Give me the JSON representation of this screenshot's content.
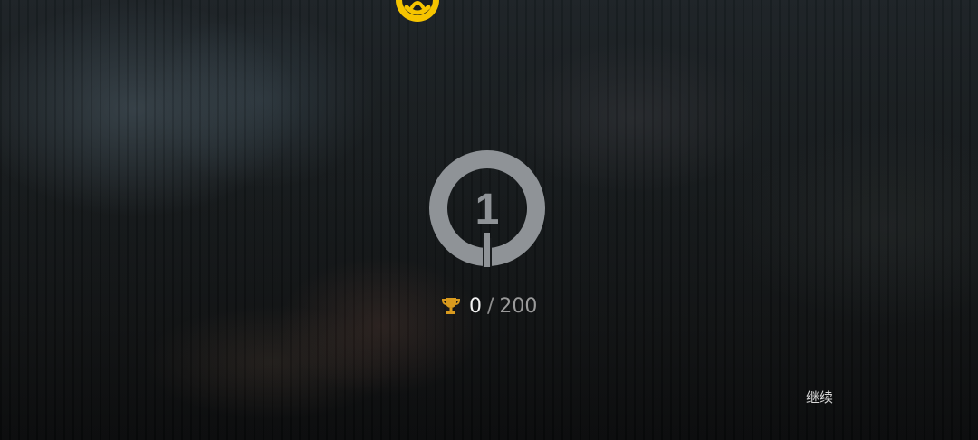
{
  "header": {
    "emblem_icon": "yellow-crest-icon",
    "emblem_color": "#f6c400"
  },
  "level": {
    "number": "1",
    "badge_color": "#8f9397",
    "badge_icon": "level-ring-icon"
  },
  "score": {
    "icon": "trophy-icon",
    "icon_color": "#d99a1e",
    "current": "0",
    "separator": "/",
    "total": "200"
  },
  "actions": {
    "continue_label": "继续"
  }
}
